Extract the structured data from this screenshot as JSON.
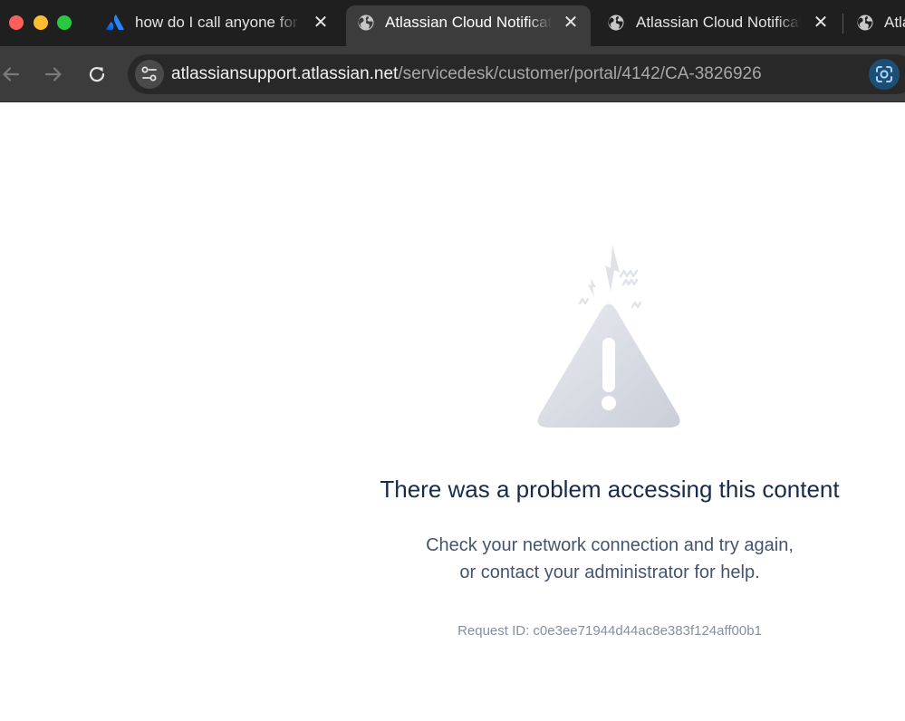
{
  "browser": {
    "tabs": [
      {
        "title": "how do I call anyone for t",
        "favicon": "atlassian-logo-icon",
        "active": false
      },
      {
        "title": "Atlassian Cloud Notificat",
        "favicon": "globe-icon",
        "active": true
      },
      {
        "title": "Atlassian Cloud Notificat",
        "favicon": "globe-icon",
        "active": false
      },
      {
        "title": "Atla",
        "favicon": "globe-icon",
        "active": false
      }
    ],
    "address_bar": {
      "host": "atlassiansupport.atlassian.net",
      "path": "/servicedesk/customer/portal/4142/CA-3826926"
    },
    "icons": {
      "back": "arrow-left-icon",
      "forward": "arrow-right-icon",
      "reload": "reload-icon",
      "site_info": "tune-icon",
      "lens": "google-lens-icon"
    },
    "colors": {
      "tab_strip": "#1f1f1f",
      "active_tab": "#3c3c3c",
      "omnibox": "#282828"
    }
  },
  "error_page": {
    "illustration": "warning-triangle-icon",
    "heading": "There was a problem accessing this content",
    "message_line1": "Check your network connection and try again,",
    "message_line2": "or contact your administrator for help.",
    "request_id": "Request ID: c0e3ee71944d44ac8e383f124aff00b1",
    "colors": {
      "heading": "#172b4d",
      "message": "#44546f",
      "request_id": "#8590a2"
    }
  }
}
